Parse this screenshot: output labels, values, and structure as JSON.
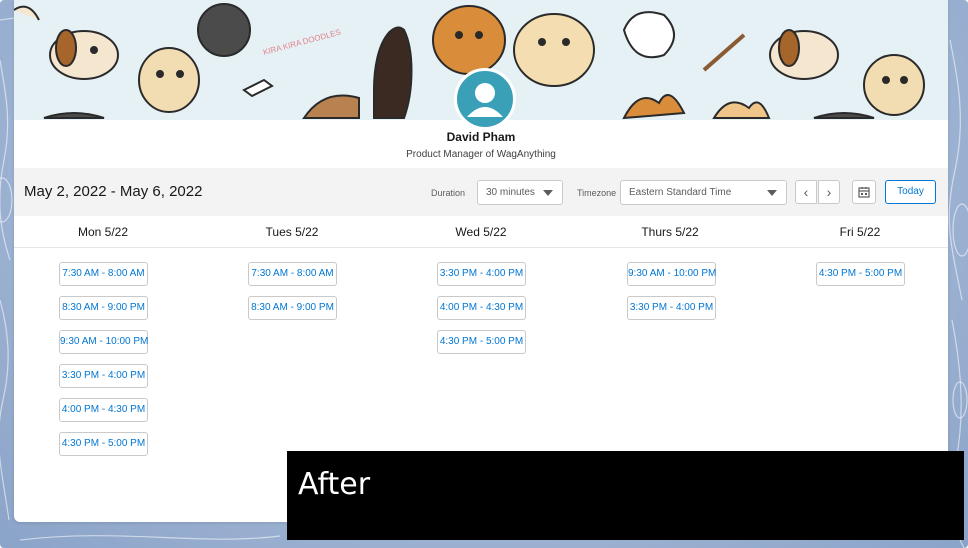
{
  "profile": {
    "name": "David Pham",
    "title": "Product Manager of WagAnything",
    "banner_text": "KIRA KIRA DOODLES"
  },
  "toolbar": {
    "date_range": "May 2, 2022 - May 6, 2022",
    "duration_label": "Duration",
    "duration_value": "30 minutes",
    "timezone_label": "Timezone",
    "timezone_value": "Eastern Standard Time",
    "prev_icon": "chevron-left-icon",
    "next_icon": "chevron-right-icon",
    "calendar_icon": "calendar-icon",
    "today_label": "Today"
  },
  "days": [
    {
      "label": "Mon  5/22",
      "slots": [
        "7:30 AM - 8:00 AM",
        "8:30 AM - 9:00 PM",
        "9:30 AM - 10:00 PM",
        "3:30 PM - 4:00 PM",
        "4:00 PM - 4:30 PM",
        "4:30 PM - 5:00 PM"
      ]
    },
    {
      "label": "Tues  5/22",
      "slots": [
        "7:30 AM - 8:00 AM",
        "8:30 AM - 9:00 PM"
      ]
    },
    {
      "label": "Wed  5/22",
      "slots": [
        "3:30 PM - 4:00 PM",
        "4:00 PM - 4:30 PM",
        "4:30 PM - 5:00 PM"
      ]
    },
    {
      "label": "Thurs  5/22",
      "slots": [
        "9:30 AM - 10:00 PM",
        "3:30 PM - 4:00 PM"
      ]
    },
    {
      "label": "Fri  5/22",
      "slots": [
        "4:30 PM - 5:00 PM"
      ]
    }
  ],
  "overlay_label": "After",
  "colors": {
    "accent": "#0176d3",
    "avatar": "#3aa0b8",
    "toolbar_bg": "#f3f3f3",
    "banner_bg": "#e6f1f6"
  }
}
